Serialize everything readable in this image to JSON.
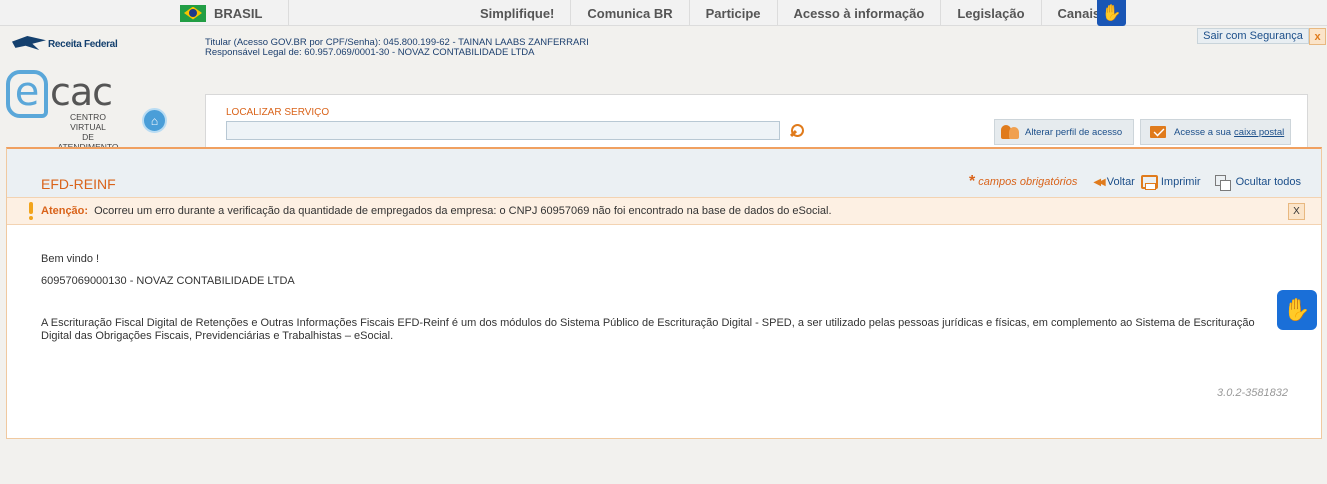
{
  "gov_bar": {
    "country": "BRASIL",
    "links": [
      "Simplifique!",
      "Comunica BR",
      "Participe",
      "Acesso à informação",
      "Legislação",
      "Canais"
    ]
  },
  "header": {
    "brand": "Receita Federal",
    "ecac_e": "e",
    "ecac_cac": "cac",
    "ecac_subtitle_line1": "CENTRO VIRTUAL",
    "ecac_subtitle_line2": "DE ATENDIMENTO",
    "titular_line": "Titular (Acesso GOV.BR por CPF/Senha): 045.800.199-62 - TAINAN LAABS ZANFERRARI",
    "responsavel_line": "Responsável Legal de: 60.957.069/0001-30 - NOVAZ CONTABILIDADE LTDA",
    "sair_label": "Sair com Segurança",
    "sair_close": "x"
  },
  "search": {
    "label": "LOCALIZAR SERVIÇO",
    "value": "",
    "placeholder": ""
  },
  "profile_buttons": {
    "perfil_label": "Alterar perfil de acesso",
    "caixa_prefix": "Acesse a sua",
    "caixa_link": "caixa postal"
  },
  "page": {
    "title": "EFD-REINF",
    "required_star": "*",
    "required_label": "campos obrigatórios",
    "back_label": "Voltar",
    "print_label": "Imprimir",
    "hide_label": "Ocultar todos"
  },
  "alert": {
    "label": "Atenção:",
    "text": "Ocorreu um erro durante a verificação da quantidade de empregados da empresa: o CNPJ 60957069 não foi encontrado na base de dados do eSocial.",
    "close": "X"
  },
  "content": {
    "welcome": "Bem vindo !",
    "company": "60957069000130 - NOVAZ CONTABILIDADE LTDA",
    "description": "A Escrituração Fiscal Digital de Retenções e Outras Informações Fiscais EFD-Reinf é um dos módulos do Sistema Público de Escrituração Digital - SPED, a ser utilizado pelas pessoas jurídicas e físicas, em complemento ao Sistema de Escrituração Digital das Obrigações Fiscais, Previdenciárias e Trabalhistas – eSocial.",
    "version": "3.0.2-3581832"
  }
}
